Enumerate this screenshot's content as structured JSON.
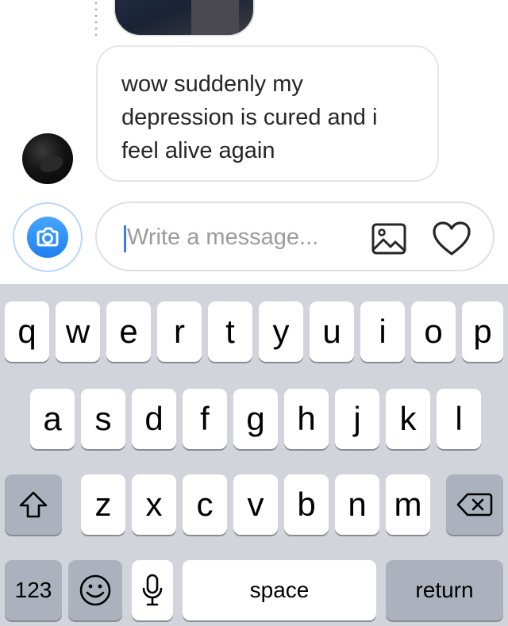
{
  "chat": {
    "message_text": "wow suddenly my\ndepression is cured and i\nfeel alive again"
  },
  "composer": {
    "placeholder": "Write a message...",
    "value": ""
  },
  "icons": {
    "camera": "camera-icon",
    "gallery": "gallery-icon",
    "heart": "heart-icon",
    "shift": "shift-icon",
    "backspace": "backspace-icon",
    "emoji": "emoji-icon",
    "mic": "microphone-icon"
  },
  "colors": {
    "accent": "#1f7ff0",
    "caret": "#3a7cf5",
    "keyboard_bg": "#d1d4da",
    "dark_key": "#acb2bd"
  },
  "keyboard": {
    "row1": [
      "q",
      "w",
      "e",
      "r",
      "t",
      "y",
      "u",
      "i",
      "o",
      "p"
    ],
    "row2": [
      "a",
      "s",
      "d",
      "f",
      "g",
      "h",
      "j",
      "k",
      "l"
    ],
    "row3": [
      "z",
      "x",
      "c",
      "v",
      "b",
      "n",
      "m"
    ],
    "numbers_label": "123",
    "space_label": "space",
    "return_label": "return"
  }
}
